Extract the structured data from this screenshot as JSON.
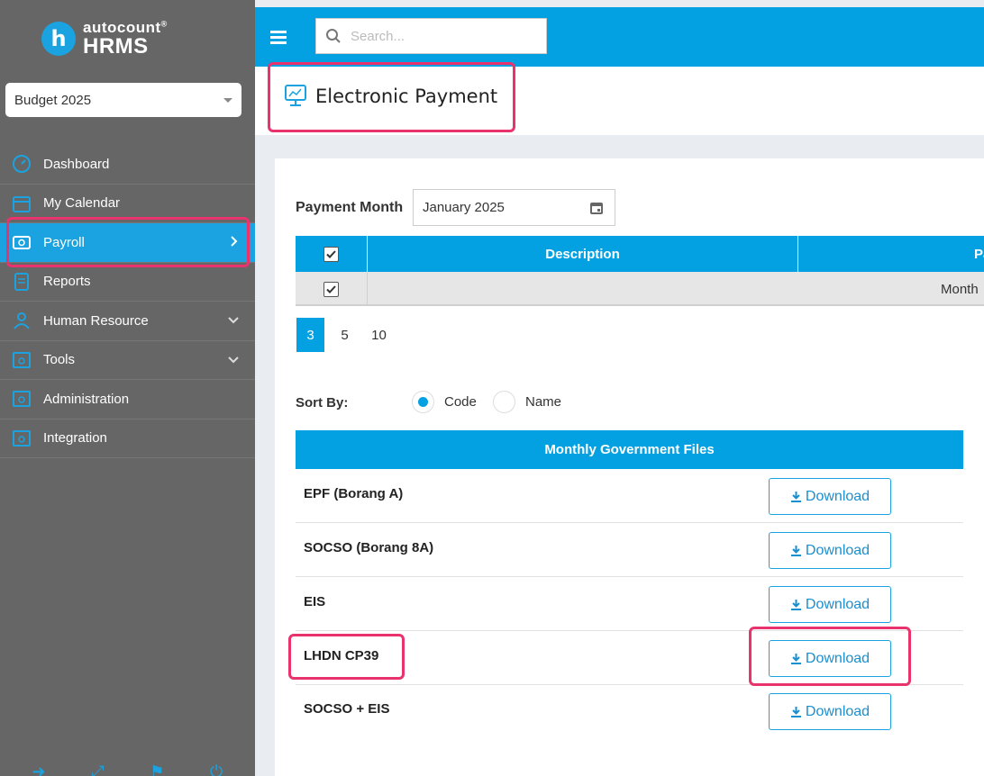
{
  "brand": {
    "logo_letter": "h",
    "name_top": "autocount",
    "name_mark": "®",
    "name_bottom": "HRMS",
    "accent_color": "#03a1e2",
    "sidebar_color": "#666666",
    "highlight_color": "#e8336d"
  },
  "sidebar": {
    "selector_value": "Budget 2025",
    "items": [
      {
        "label": "Dashboard",
        "icon": "dashboard-icon",
        "arrow": ""
      },
      {
        "label": "My Calendar",
        "icon": "calendar-icon",
        "arrow": ""
      },
      {
        "label": "Payroll",
        "icon": "payroll-icon",
        "arrow": ">"
      },
      {
        "label": "Reports",
        "icon": "reports-icon",
        "arrow": ""
      },
      {
        "label": "Human Resource",
        "icon": "human-resource-icon",
        "arrow": "v"
      },
      {
        "label": "Tools",
        "icon": "tools-icon",
        "arrow": "v"
      },
      {
        "label": "Administration",
        "icon": "administration-icon",
        "arrow": ""
      },
      {
        "label": "Integration",
        "icon": "integration-icon",
        "arrow": ""
      }
    ],
    "active_item": "Payroll"
  },
  "topbar": {
    "search_placeholder": "Search..."
  },
  "page": {
    "title": "Electronic Payment"
  },
  "payment": {
    "month_label": "Payment Month",
    "month_value": "January 2025",
    "table": {
      "headers": [
        "Description",
        "Pa"
      ],
      "row_value": "Month"
    },
    "page_sizes": [
      "3",
      "5",
      "10"
    ],
    "active_page_size": "3"
  },
  "sort": {
    "label": "Sort By:",
    "options": [
      "Code",
      "Name"
    ],
    "selected": "Code"
  },
  "gov_files": {
    "title": "Monthly Government Files",
    "download_label": "Download",
    "rows": [
      {
        "name": "EPF (Borang A)"
      },
      {
        "name": "SOCSO (Borang 8A)"
      },
      {
        "name": "EIS"
      },
      {
        "name": "LHDN CP39"
      },
      {
        "name": "SOCSO + EIS"
      }
    ]
  }
}
